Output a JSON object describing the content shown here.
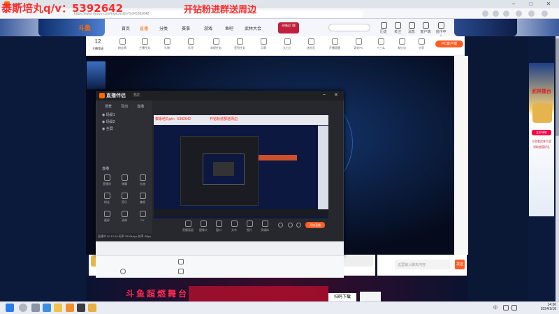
{
  "overlay": {
    "left_text": "泰斯培丸q/v：5392642",
    "right_text": "开钻粉进群送周边"
  },
  "browser": {
    "tab_title": "斗鱼",
    "url": "https://www.douyu.com/topic/ssdm?rid=5392642",
    "close": "✕"
  },
  "header": {
    "logo": "斗鱼",
    "nav": [
      "首页",
      "直播",
      "分类",
      "赛事",
      "游戏",
      "鱼吧",
      "武林大会"
    ],
    "promo_badge": "开播送门票",
    "icons": [
      "历史",
      "关注",
      "消息",
      "客户端",
      "创作中心"
    ]
  },
  "toolbar": {
    "count": "12",
    "count_label": "主播等级",
    "items": [
      "粉丝牌",
      "主播任务",
      "礼物",
      "乐评",
      "常规任务",
      "签到任务",
      "月票",
      "大力士",
      "送钻石",
      "开播提醒",
      "奇妙PK",
      "十三幺",
      "发红包",
      "分享"
    ],
    "pc_button": "PC客户端"
  },
  "ad": {
    "title": "武林擂台",
    "lines": [
      "斗鱼看武林大会",
      "领取超值好礼"
    ],
    "button": "立即领取"
  },
  "tool_window": {
    "title": "直播伴侣",
    "version": "6.2",
    "tabs": [
      "场景",
      "互动",
      "直播"
    ],
    "scenes": [
      "场景1",
      "场景2",
      "全屏"
    ],
    "section": "直播",
    "buttons": [
      "直播间",
      "弹幕",
      "礼物",
      "粉丝",
      "音乐",
      "美颜",
      "截屏",
      "录像",
      "PK"
    ],
    "preview_red_1": "泰斯培丸q/v：5392642",
    "preview_red_2": "开钻粉进群送周边",
    "bottom_tools": [
      "直播画面",
      "摄像头",
      "窗口",
      "文字",
      "图片",
      "多媒体"
    ],
    "start_button": "开始直播",
    "status": "直播中 00:12:34  码率 2500kbps  帧率 30fps"
  },
  "chat": {
    "placeholder": "这里输入聊天内容",
    "send": "发送"
  },
  "stage": {
    "text": "斗鱼超燃舞台",
    "qr_label": "扫码下载"
  },
  "taskbar": {
    "ime": "中",
    "time": "14:36",
    "date": "2024/1/18"
  }
}
